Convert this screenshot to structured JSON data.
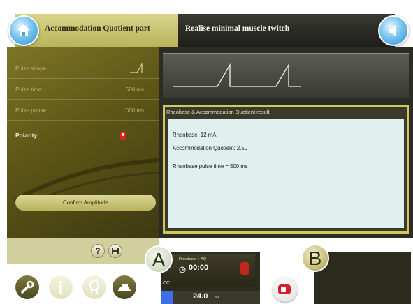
{
  "header": {
    "left_tab": "Accommodation Quotient part",
    "right_tab": "Realise minimal muscle twitch"
  },
  "settings": {
    "pulse_shape_label": "Pulse shape",
    "pulse_time_label": "Pulse time",
    "pulse_time_value": "500 ms",
    "pulse_pause_label": "Pulse pause",
    "pulse_pause_value": "1000 ms",
    "polarity_label": "Polarity",
    "confirm_label": "Confirm Amplitude"
  },
  "result": {
    "title": "Rheobase & Accommodation Quotient result",
    "rheobase": "Rheobase: 12 mA",
    "quotient": "Accommodation Quotient: 2.50",
    "pulse_time": "Rheobase pulse time = 500 ms"
  },
  "channel_a": {
    "badge": "A",
    "name": "Rheobase + AQ",
    "timer": "00:00",
    "mode": "CC",
    "amplitude": "24.0",
    "unit": "mA"
  },
  "channel_b": {
    "badge": "B"
  },
  "colors": {
    "panel_olive": "#5d5516",
    "accent_yellow": "#d2c85a",
    "result_bg": "#dff0ee",
    "stop_red": "#c0281e",
    "amplitude_blue": "#3c6ee8"
  },
  "icons": [
    "home-icon",
    "sound-icon",
    "pulse-shape-icon",
    "polarity-icon",
    "help-icon",
    "save-icon",
    "wrench-icon",
    "info-icon",
    "head-icon",
    "device-icon",
    "stop-icon",
    "clock-icon"
  ]
}
